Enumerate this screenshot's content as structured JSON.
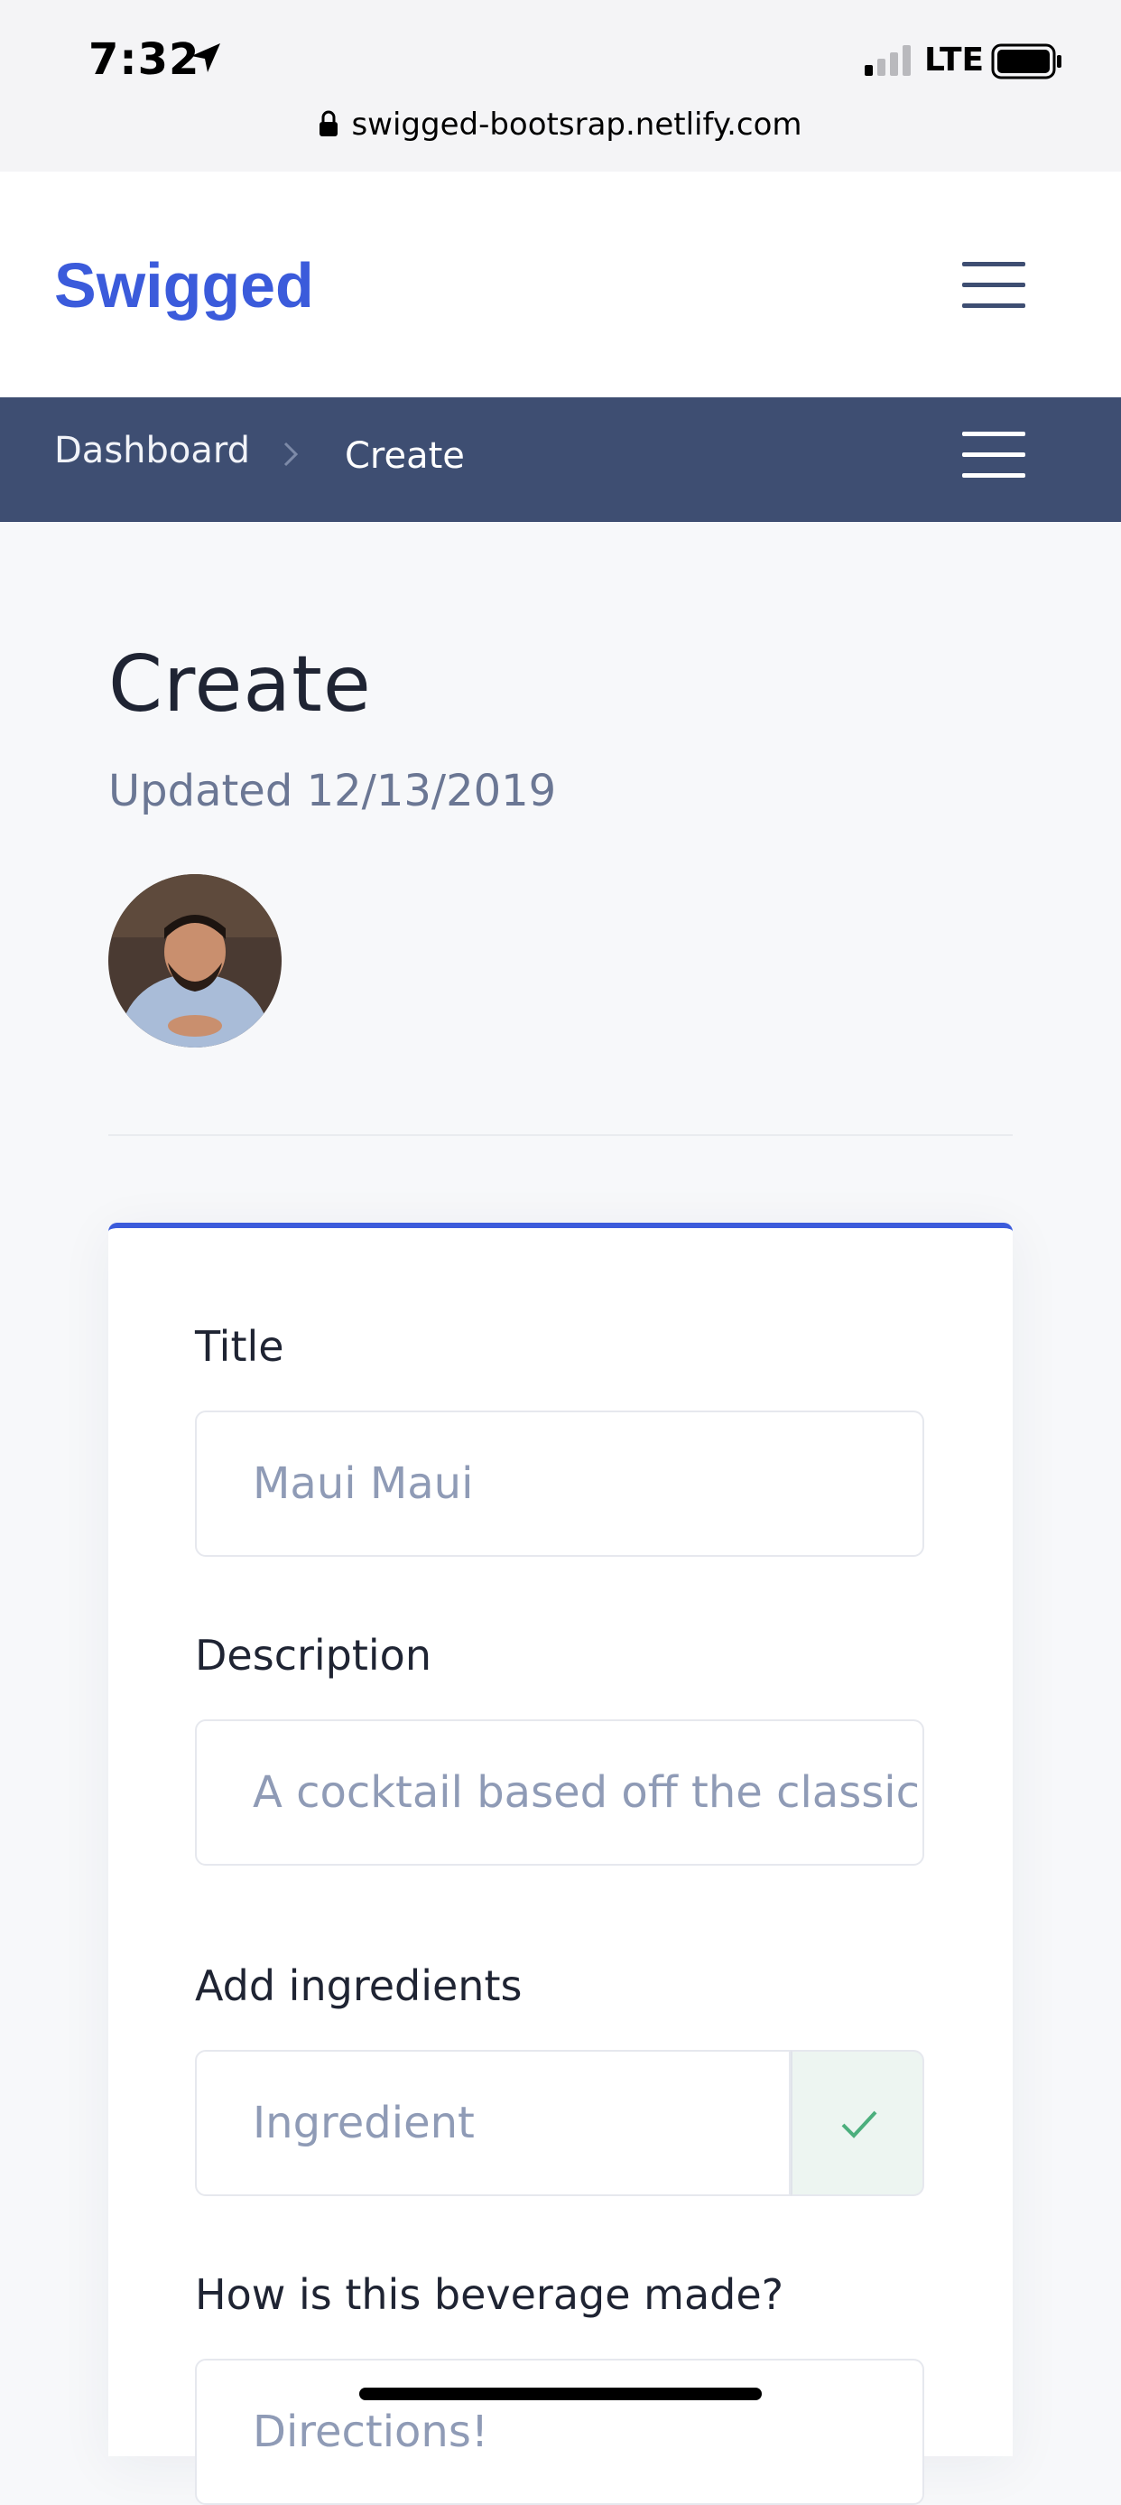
{
  "status_bar": {
    "time": "7:32",
    "network": "LTE",
    "url": "swigged-bootsrap.netlify.com",
    "icons": [
      "location-arrow-icon",
      "signal-icon",
      "battery-icon",
      "lock-icon"
    ]
  },
  "nav": {
    "brand": "Swigged",
    "brand_color": "#3b5bdb",
    "menu_icon": "hamburger-icon"
  },
  "breadcrumb": {
    "items": [
      "Dashboard",
      "Create"
    ],
    "bar_color": "#3e4e72",
    "separator_icon": "chevron-right-icon"
  },
  "header": {
    "title": "Create",
    "updated": "Updated 12/13/2019",
    "avatar_icon": "user-avatar"
  },
  "form": {
    "title_label": "Title",
    "title_value": "Maui Maui",
    "description_label": "Description",
    "description_value": "A cocktail based off the classic",
    "ingredients_label": "Add ingredients",
    "ingredient_placeholder": "Ingredient",
    "ingredient_confirm_icon": "check-icon",
    "directions_label": "How is this beverage made?",
    "directions_placeholder": "Directions!"
  }
}
